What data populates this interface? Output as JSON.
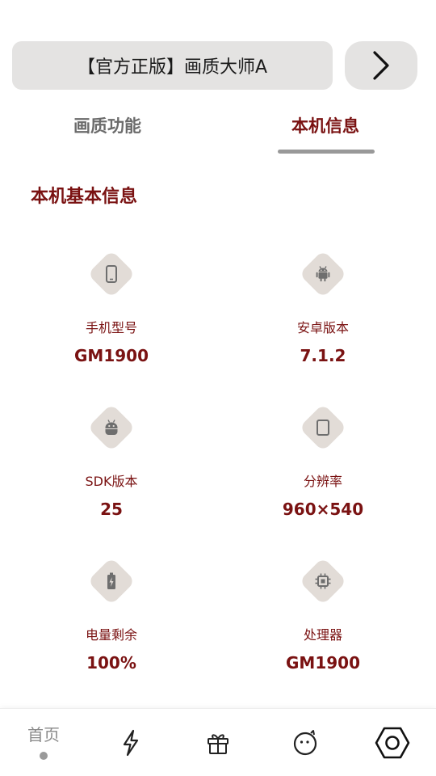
{
  "banner": {
    "text": "【官方正版】画质大师A"
  },
  "tabs": [
    {
      "label": "画质功能",
      "active": false
    },
    {
      "label": "本机信息",
      "active": true
    }
  ],
  "section": {
    "title": "本机基本信息"
  },
  "info": [
    {
      "label": "手机型号",
      "value": "GM1900",
      "icon": "phone-icon"
    },
    {
      "label": "安卓版本",
      "value": "7.1.2",
      "icon": "android-icon"
    },
    {
      "label": "SDK版本",
      "value": "25",
      "icon": "android-head-icon"
    },
    {
      "label": "分辨率",
      "value": "960×540",
      "icon": "screen-icon"
    },
    {
      "label": "电量剩余",
      "value": "100%",
      "icon": "battery-icon"
    },
    {
      "label": "处理器",
      "value": "GM1900",
      "icon": "cpu-icon"
    }
  ],
  "nav": {
    "home_label": "首页",
    "items": [
      "home",
      "boost-icon",
      "gift-icon",
      "face-icon",
      "settings-icon"
    ]
  },
  "colors": {
    "accent": "#7a1212",
    "button_bg": "#e4e3e2",
    "icon_bg": "#e2dcd7",
    "icon_fg": "#6e6e6e"
  }
}
